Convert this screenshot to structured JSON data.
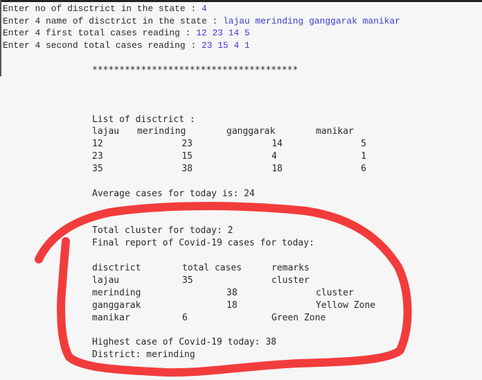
{
  "input_prompts": [
    {
      "prompt": "Enter no of disctrict in the state : ",
      "value": "4"
    },
    {
      "prompt": "Enter 4 name of disctrict in the state : ",
      "value": "lajau merinding ganggarak manikar"
    },
    {
      "prompt": "Enter 4 first total cases reading : ",
      "value": "12 23 14 5"
    },
    {
      "prompt": "Enter 4 second total cases reading : ",
      "value": "23 15 4 1"
    }
  ],
  "separator": "**************************************",
  "list": {
    "title": "List of disctrict :",
    "headers": [
      "lajau",
      "merinding",
      "ganggarak",
      "manikar"
    ],
    "rows": [
      [
        "12",
        "23",
        "14",
        "5"
      ],
      [
        "23",
        "15",
        "4",
        "1"
      ],
      [
        "35",
        "38",
        "18",
        "6"
      ]
    ]
  },
  "average": "Average cases for today is: 24",
  "total_cluster": "Total cluster for today: 2",
  "final_report": "Final report of Covid-19 cases for today:",
  "report": {
    "headers": [
      "disctrict",
      "total cases",
      "remarks"
    ],
    "rows": [
      [
        "lajau",
        "35",
        "cluster"
      ],
      [
        "merinding",
        "38",
        "cluster"
      ],
      [
        "ganggarak",
        "18",
        "Yellow Zone"
      ],
      [
        "manikar",
        "6",
        "Green Zone"
      ]
    ]
  },
  "highest": "Highest case of Covid-19 today: 38",
  "district": "District: merinding",
  "colors": {
    "input": "#3a3ad0",
    "annotation": "#f23c3c"
  }
}
